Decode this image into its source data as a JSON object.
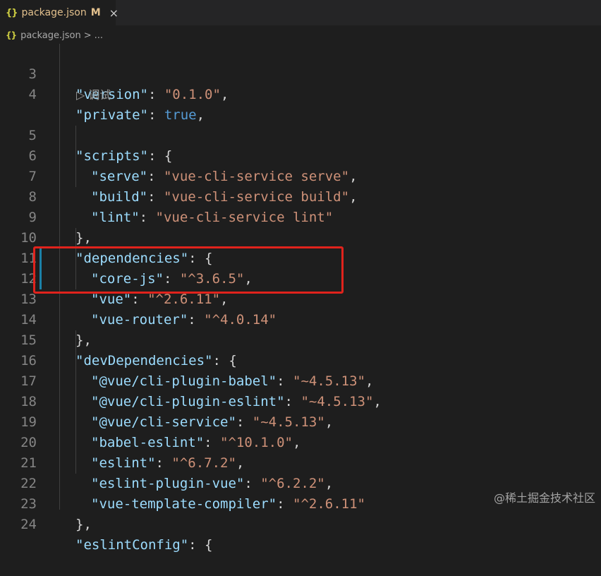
{
  "tab": {
    "icon": "{}",
    "filename": "package.json",
    "modified_badge": "M",
    "close_icon": "×"
  },
  "breadcrumb": {
    "icon": "{}",
    "file": "package.json",
    "separator": ">",
    "rest": "..."
  },
  "codelens": {
    "label": "▷ 调试"
  },
  "lines": [
    {
      "num": "3"
    },
    {
      "num": "4"
    },
    {
      "num": "5"
    },
    {
      "num": "6"
    },
    {
      "num": "7"
    },
    {
      "num": "8"
    },
    {
      "num": "9"
    },
    {
      "num": "10"
    },
    {
      "num": "11"
    },
    {
      "num": "12"
    },
    {
      "num": "13"
    },
    {
      "num": "14"
    },
    {
      "num": "15"
    },
    {
      "num": "16"
    },
    {
      "num": "17"
    },
    {
      "num": "18"
    },
    {
      "num": "19"
    },
    {
      "num": "20"
    },
    {
      "num": "21"
    },
    {
      "num": "22"
    },
    {
      "num": "23"
    },
    {
      "num": "24"
    }
  ],
  "code": {
    "l3_key": "\"version\"",
    "l3_val": "\"0.1.0\"",
    "l4_key": "\"private\"",
    "l4_val": "true",
    "l5_key": "\"scripts\"",
    "l6_key": "\"serve\"",
    "l6_val": "\"vue-cli-service serve\"",
    "l7_key": "\"build\"",
    "l7_val": "\"vue-cli-service build\"",
    "l8_key": "\"lint\"",
    "l8_val": "\"vue-cli-service lint\"",
    "l10_key": "\"dependencies\"",
    "l11_key": "\"core-js\"",
    "l11_val": "\"^3.6.5\"",
    "l12_key": "\"vue\"",
    "l12_val": "\"^2.6.11\"",
    "l13_key": "\"vue-router\"",
    "l13_val": "\"^4.0.14\"",
    "l15_key": "\"devDependencies\"",
    "l16_key": "\"@vue/cli-plugin-babel\"",
    "l16_val": "\"~4.5.13\"",
    "l17_key": "\"@vue/cli-plugin-eslint\"",
    "l17_val": "\"~4.5.13\"",
    "l18_key": "\"@vue/cli-service\"",
    "l18_val": "\"~4.5.13\"",
    "l19_key": "\"babel-eslint\"",
    "l19_val": "\"^10.1.0\"",
    "l20_key": "\"eslint\"",
    "l20_val": "\"^6.7.2\"",
    "l21_key": "\"eslint-plugin-vue\"",
    "l21_val": "\"^6.2.2\"",
    "l22_key": "\"vue-template-compiler\"",
    "l22_val": "\"^2.6.11\"",
    "l24_key": "\"eslintConfig\""
  },
  "watermark": "@稀土掘金技术社区",
  "colors": {
    "key": "#9cdcfe",
    "string": "#ce9178",
    "boolean": "#569cd6",
    "highlight_box": "#e0231c"
  }
}
